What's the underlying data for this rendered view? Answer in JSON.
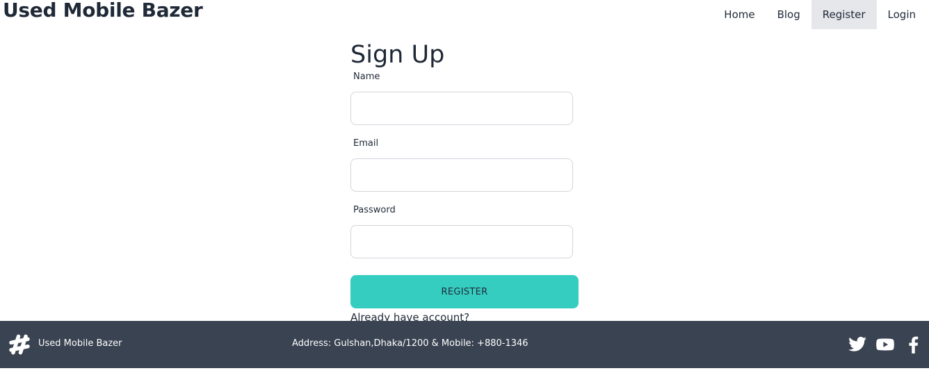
{
  "header": {
    "brand": "Used Mobile Bazer",
    "nav": [
      {
        "label": "Home"
      },
      {
        "label": "Blog"
      },
      {
        "label": "Register"
      },
      {
        "label": "Login"
      }
    ],
    "active_nav": "Register"
  },
  "form": {
    "title": "Sign Up",
    "fields": {
      "name": {
        "label": "Name",
        "value": "",
        "placeholder": ""
      },
      "email": {
        "label": "Email",
        "value": "",
        "placeholder": ""
      },
      "password": {
        "label": "Password",
        "value": "",
        "placeholder": ""
      }
    },
    "submit_label": "REGISTER",
    "login_link": "Already have account?"
  },
  "footer": {
    "logo_icon": "hashtag-icon",
    "brand": "Used Mobile Bazer",
    "address": "Address: Gulshan,Dhaka/1200 & Mobile: +880-1346",
    "social": [
      "twitter-icon",
      "youtube-icon",
      "facebook-icon"
    ]
  },
  "colors": {
    "accent": "#36cdc1",
    "footer_bg": "#3a4351",
    "active_nav_bg": "#e5e7eb"
  }
}
